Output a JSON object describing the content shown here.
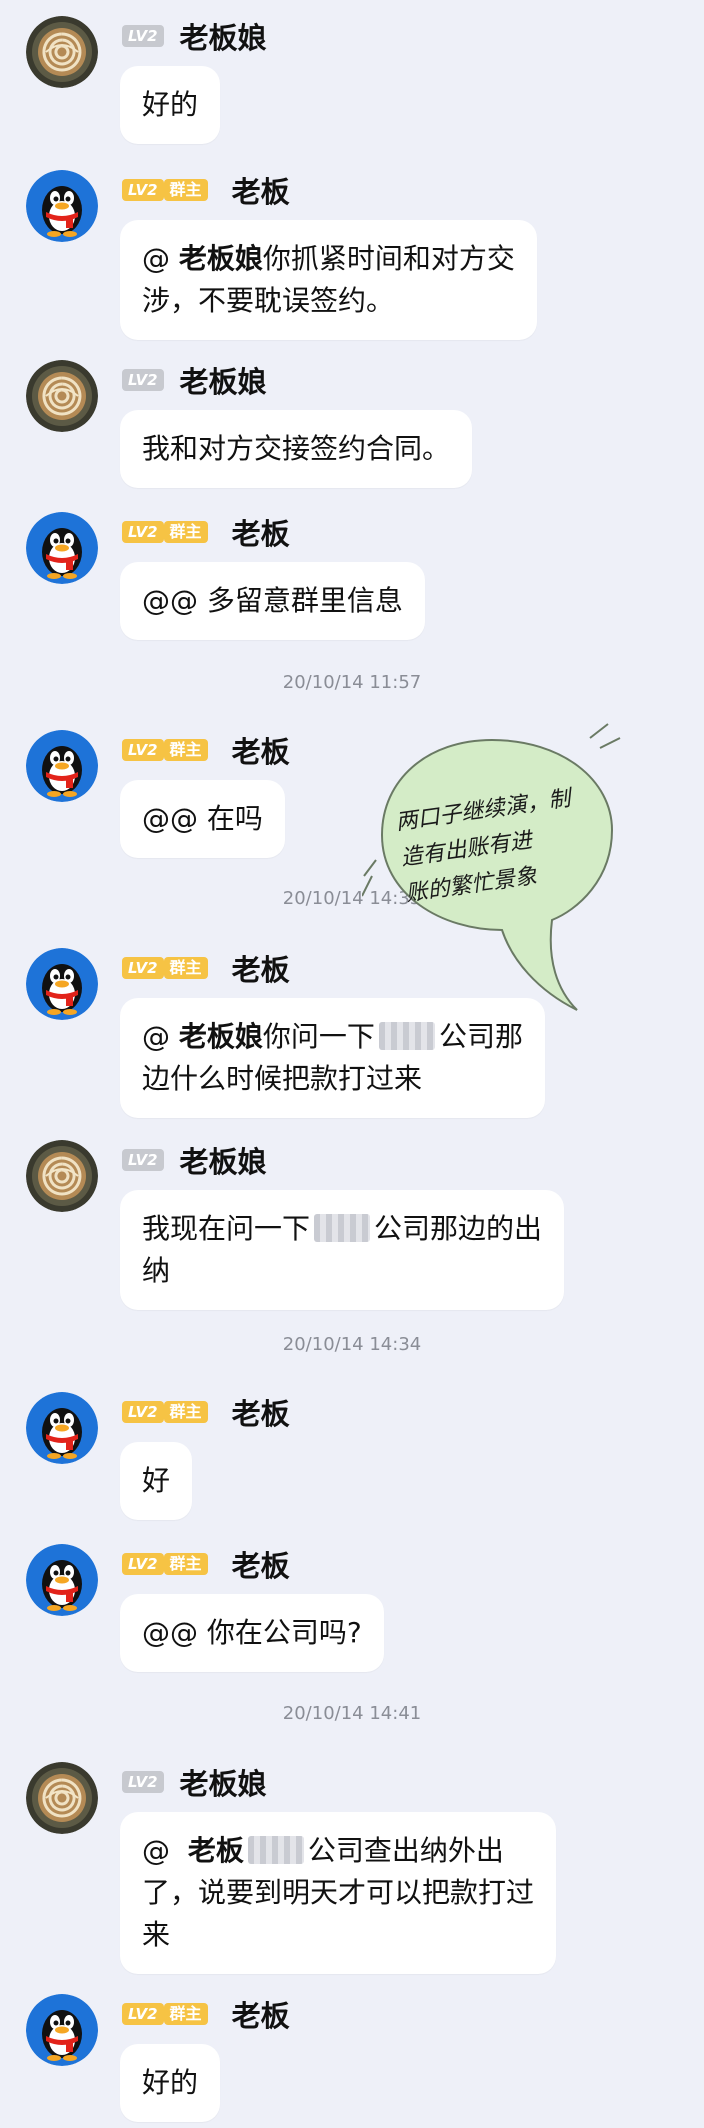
{
  "users": {
    "boss_wife": {
      "name": "老板娘",
      "level": "LV2"
    },
    "boss": {
      "name": "老板",
      "level": "LV2",
      "role": "群主"
    }
  },
  "messages": [
    {
      "id": "m1",
      "sender": "老板娘",
      "level": "LV2",
      "role": "",
      "text": "好的"
    },
    {
      "id": "m2",
      "sender": "老板",
      "level": "LV2",
      "role": "群主",
      "prefix": "@ ",
      "mention": "老板娘",
      "text": "你抓紧时间和对方交\n涉，不要耽误签约。"
    },
    {
      "id": "m3",
      "sender": "老板娘",
      "level": "LV2",
      "role": "",
      "text": "我和对方交接签约合同。"
    },
    {
      "id": "m4",
      "sender": "老板",
      "level": "LV2",
      "role": "群主",
      "text": "@@ 多留意群里信息"
    },
    {
      "id": "m5",
      "sender": "老板",
      "level": "LV2",
      "role": "群主",
      "text": "@@ 在吗"
    },
    {
      "id": "m6",
      "sender": "老板",
      "level": "LV2",
      "role": "群主",
      "prefix": "@ ",
      "mention": "老板娘",
      "text_a": "你问一下",
      "text_b": "公司那\n边什么时候把款打过来"
    },
    {
      "id": "m7",
      "sender": "老板娘",
      "level": "LV2",
      "role": "",
      "text_a": "我现在问一下",
      "text_b": "公司那边的出\n纳"
    },
    {
      "id": "m8",
      "sender": "老板",
      "level": "LV2",
      "role": "群主",
      "text": "好"
    },
    {
      "id": "m9",
      "sender": "老板",
      "level": "LV2",
      "role": "群主",
      "text": "@@ 你在公司吗?"
    },
    {
      "id": "m10",
      "sender": "老板娘",
      "level": "LV2",
      "role": "",
      "prefix": "@  ",
      "mention": "老板",
      "text_b": "公司查出纳外出\n了，说要到明天才可以把款打过\n来"
    },
    {
      "id": "m11",
      "sender": "老板",
      "level": "LV2",
      "role": "群主",
      "text": "好的"
    }
  ],
  "timestamps": [
    "20/10/14 11:57",
    "20/10/14 14:33",
    "20/10/14 14:34",
    "20/10/14 14:41"
  ],
  "annotation": {
    "text_line1": "两口子继续演，制",
    "text_line2": "造有出账有进",
    "text_line3": "账的繁忙景象",
    "color": "#d4ecc7"
  },
  "colors": {
    "background": "#eef0f8",
    "owner_badge": "#f6c344",
    "level_badge": "#c7c9cf"
  }
}
